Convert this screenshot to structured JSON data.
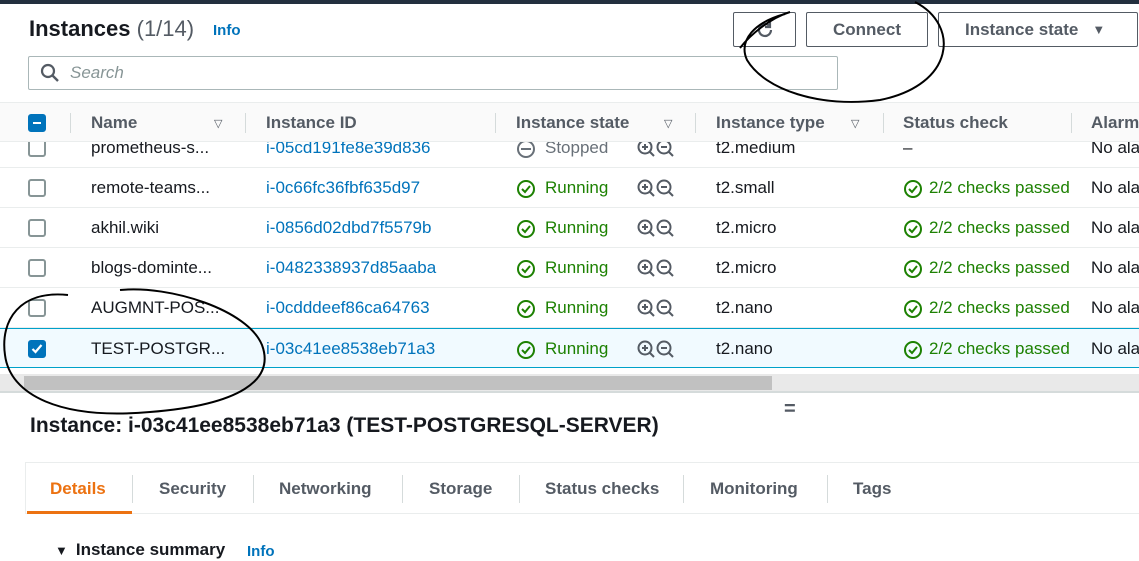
{
  "header": {
    "title": "Instances",
    "count": "(1/14)",
    "info": "Info",
    "connect_label": "Connect",
    "instance_state_label": "Instance state"
  },
  "search": {
    "placeholder": "Search"
  },
  "table": {
    "columns": [
      "Name",
      "Instance ID",
      "Instance state",
      "Instance type",
      "Status check",
      "Alarm"
    ],
    "rows": [
      {
        "name": "prometheus-s...",
        "instance_id": "i-05cd191fe8e39d836",
        "state": "Stopped",
        "type": "t2.medium",
        "status_check": "–",
        "alarm": "No ala",
        "selected": false
      },
      {
        "name": "remote-teams...",
        "instance_id": "i-0c66fc36fbf635d97",
        "state": "Running",
        "type": "t2.small",
        "status_check": "2/2 checks passed",
        "alarm": "No ala",
        "selected": false
      },
      {
        "name": "akhil.wiki",
        "instance_id": "i-0856d02dbd7f5579b",
        "state": "Running",
        "type": "t2.micro",
        "status_check": "2/2 checks passed",
        "alarm": "No ala",
        "selected": false
      },
      {
        "name": "blogs-dominte...",
        "instance_id": "i-0482338937d85aaba",
        "state": "Running",
        "type": "t2.micro",
        "status_check": "2/2 checks passed",
        "alarm": "No ala",
        "selected": false
      },
      {
        "name": "AUGMNT-POS...",
        "instance_id": "i-0cdddeef86ca64763",
        "state": "Running",
        "type": "t2.nano",
        "status_check": "2/2 checks passed",
        "alarm": "No ala",
        "selected": false
      },
      {
        "name": "TEST-POSTGR...",
        "instance_id": "i-03c41ee8538eb71a3",
        "state": "Running",
        "type": "t2.nano",
        "status_check": "2/2 checks passed",
        "alarm": "No ala",
        "selected": true
      }
    ]
  },
  "detail": {
    "title": "Instance: i-03c41ee8538eb71a3 (TEST-POSTGRESQL-SERVER)",
    "tabs": [
      "Details",
      "Security",
      "Networking",
      "Storage",
      "Status checks",
      "Monitoring",
      "Tags"
    ],
    "active_tab": "Details",
    "section": "Instance summary",
    "section_info": "Info"
  },
  "colors": {
    "link": "#0073bb",
    "running": "#1d8102",
    "accent": "#ec7211",
    "selected_border": "#00a1c9"
  }
}
